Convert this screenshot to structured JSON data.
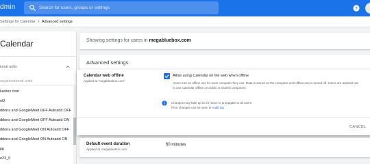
{
  "header": {
    "app_name": "dmin",
    "search_placeholder": "Search for users, groups or settings",
    "accent": "#1a73e8"
  },
  "breadcrumb": {
    "parent": "Settings for Calendar",
    "separator": ">",
    "current": "Advanced settings"
  },
  "left": {
    "title": "Calendar",
    "ou_header": "ional units",
    "search_hint": "organisational units",
    "items": [
      "luebox.com",
      "oO",
      "ddons and GoogleMeet OFF Autoadd OFF",
      "ddons and GoogleMeet OFF Autoadd ON",
      "ddons and GoogleMeet ON Autoadd OFF",
      "ddons and GoogleMeet ON Autoadd ON",
      "pp",
      "e23_0"
    ]
  },
  "main": {
    "showing_prefix": "Showing settings for users in ",
    "showing_domain": "megabluebox.com",
    "advanced_title": "Advanced settings",
    "offline": {
      "name": "Calendar web offline",
      "applied": "Applied at 'megabluebox.com'",
      "checkbox_checked": true,
      "checkbox_label": "Allow using Calendar on the web when offline",
      "description": "Users turn on offline use for each computer they use. Data is stored on the computer until offline use is turned off. Users are advised not to use Calendar offline on public or shared computers",
      "info_line1": "Changes may take up to 24 hours to propagate to all users.",
      "info_line2_prefix": "Prior changes can be seen in ",
      "info_link": "Audit log",
      "cancel_label": "CANCEL"
    },
    "default_event": {
      "name": "Default event duration",
      "applied": "Applied at 'megabluebox.com'",
      "value": "60 minutes"
    }
  }
}
